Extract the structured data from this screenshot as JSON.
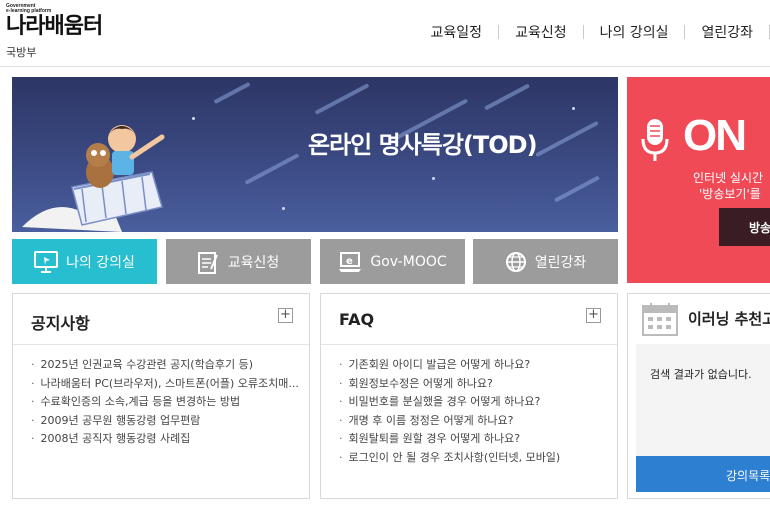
{
  "logo": {
    "sub_line1": "Government",
    "sub_line2": "e-learning platform",
    "name": "나라배움터",
    "org": "국방부"
  },
  "nav": [
    "교육일정",
    "교육신청",
    "나의 강의실",
    "열린강좌"
  ],
  "banner": {
    "title": "온라인 명사특강(TOD)"
  },
  "live": {
    "title": "ON",
    "line1": "인터넷 실시간",
    "line2": "'방송보기'를",
    "button": "방송"
  },
  "quick_buttons": [
    {
      "label": "나의 강의실",
      "icon": "monitor-icon"
    },
    {
      "label": "교육신청",
      "icon": "form-icon"
    },
    {
      "label": "Gov-MOOC",
      "icon": "laptop-e-icon"
    },
    {
      "label": "열린강좌",
      "icon": "globe-icon"
    }
  ],
  "notice": {
    "title": "공지사항",
    "items": [
      "2025년 인권교육 수강관련 공지(학습후기 등)",
      "나라배움터 PC(브라우저), 스마트폰(어플) 오류조치매...",
      "수료확인증의 소속,계급 등을 변경하는 방법",
      "2009년 공무원 행동강령 업무편람",
      "2008년 공직자 행동강령 사례집"
    ]
  },
  "faq": {
    "title": "FAQ",
    "items": [
      "기존회원 아이디 발급은 어떻게 하나요?",
      "회원정보수정은 어떻게 하나요?",
      "비밀번호를 분실했을 경우 어떻게 하나요?",
      "개명 후 이름 정정은 어떻게 하나요?",
      "회원탈퇴를 원할 경우 어떻게 하나요?",
      "로그인이 안 될 경우 조치사항(인터넷, 모바일)"
    ]
  },
  "elearning": {
    "title": "이러닝 추천고",
    "empty": "검색 결과가 없습니다.",
    "button": "강의목록"
  },
  "plus_label": "+",
  "colors": {
    "accent_teal": "#27bfcf",
    "button_gray": "#9c9c9c",
    "live_red": "#f04a57",
    "banner_navy": "#2d3665",
    "blue_button": "#2c7fd1"
  }
}
